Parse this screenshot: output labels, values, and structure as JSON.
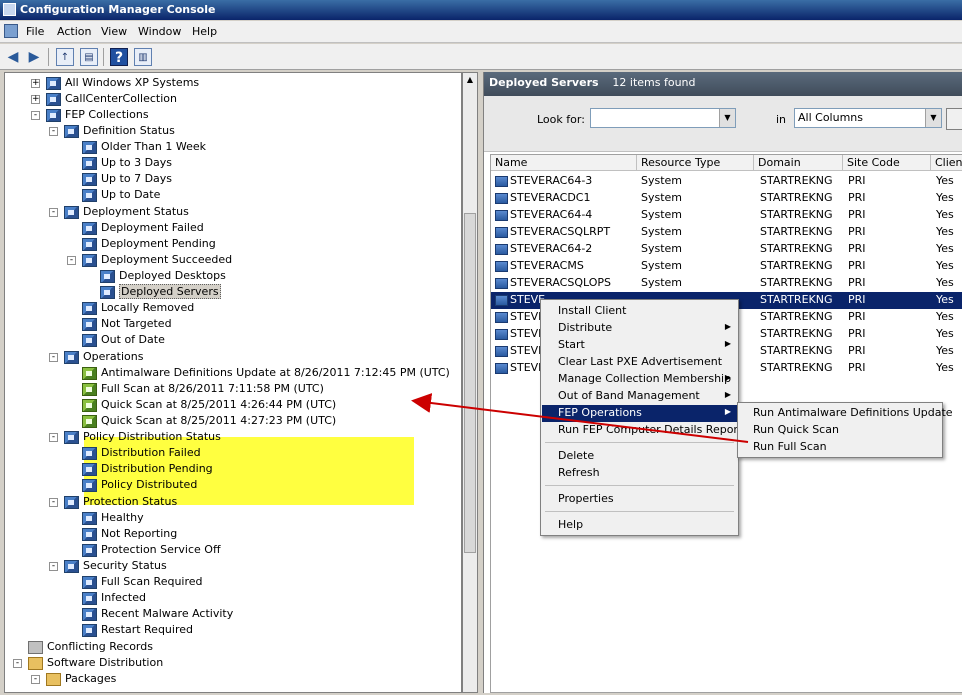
{
  "window": {
    "title": "Configuration Manager Console"
  },
  "menubar": {
    "items": [
      "File",
      "Action",
      "View",
      "Window",
      "Help"
    ]
  },
  "tree": {
    "nodes": [
      "All Windows XP Systems",
      "CallCenterCollection",
      "FEP Collections",
      "Definition Status",
      "Older Than 1 Week",
      "Up to 3 Days",
      "Up to 7 Days",
      "Up to Date",
      "Deployment Status",
      "Deployment Failed",
      "Deployment Pending",
      "Deployment Succeeded",
      "Deployed Desktops",
      "Deployed Servers",
      "Locally Removed",
      "Not Targeted",
      "Out of Date",
      "Operations",
      "Antimalware Definitions Update at 8/26/2011 7:12:45 PM (UTC)",
      "Full Scan at 8/26/2011 7:11:58 PM (UTC)",
      "Quick Scan at 8/25/2011 4:26:44 PM (UTC)",
      "Quick Scan at 8/25/2011 4:27:23 PM (UTC)",
      "Policy Distribution Status",
      "Distribution Failed",
      "Distribution Pending",
      "Policy Distributed",
      "Protection Status",
      "Healthy",
      "Not Reporting",
      "Protection Service Off",
      "Security Status",
      "Full Scan Required",
      "Infected",
      "Recent Malware Activity",
      "Restart Required",
      "Conflicting Records",
      "Software Distribution",
      "Packages"
    ]
  },
  "details": {
    "title": "Deployed Servers",
    "count": "12 items found",
    "look_for_label": "Look for:",
    "look_for_value": "",
    "in_label": "in",
    "in_value": "All Columns",
    "columns": [
      "Name",
      "Resource Type",
      "Domain",
      "Site Code",
      "Client"
    ],
    "rows": [
      [
        "STEVERAC64-3",
        "System",
        "STARTREKNG",
        "PRI",
        "Yes"
      ],
      [
        "STEVERACDC1",
        "System",
        "STARTREKNG",
        "PRI",
        "Yes"
      ],
      [
        "STEVERAC64-4",
        "System",
        "STARTREKNG",
        "PRI",
        "Yes"
      ],
      [
        "STEVERACSQLRPT",
        "System",
        "STARTREKNG",
        "PRI",
        "Yes"
      ],
      [
        "STEVERAC64-2",
        "System",
        "STARTREKNG",
        "PRI",
        "Yes"
      ],
      [
        "STEVERACMS",
        "System",
        "STARTREKNG",
        "PRI",
        "Yes"
      ],
      [
        "STEVERACSQLOPS",
        "System",
        "STARTREKNG",
        "PRI",
        "Yes"
      ],
      [
        "STEVE",
        "",
        "STARTREKNG",
        "PRI",
        "Yes"
      ],
      [
        "STEVE",
        "",
        "STARTREKNG",
        "PRI",
        "Yes"
      ],
      [
        "STEVE",
        "",
        "STARTREKNG",
        "PRI",
        "Yes"
      ],
      [
        "STEVE",
        "",
        "STARTREKNG",
        "PRI",
        "Yes"
      ],
      [
        "STEVE",
        "",
        "STARTREKNG",
        "PRI",
        "Yes"
      ]
    ]
  },
  "context_menu": {
    "items": [
      "Install Client",
      "Distribute",
      "Start",
      "Clear Last PXE Advertisement",
      "Manage Collection Membership",
      "Out of Band Management",
      "FEP Operations",
      "Run FEP Computer Details Report",
      "Delete",
      "Refresh",
      "Properties",
      "Help"
    ]
  },
  "submenu": {
    "items": [
      "Run Antimalware Definitions Update",
      "Run Quick Scan",
      "Run Full Scan"
    ]
  },
  "colors": {
    "highlight": "#ffff40",
    "arrow": "#cc0000",
    "selection": "#0a246a"
  }
}
